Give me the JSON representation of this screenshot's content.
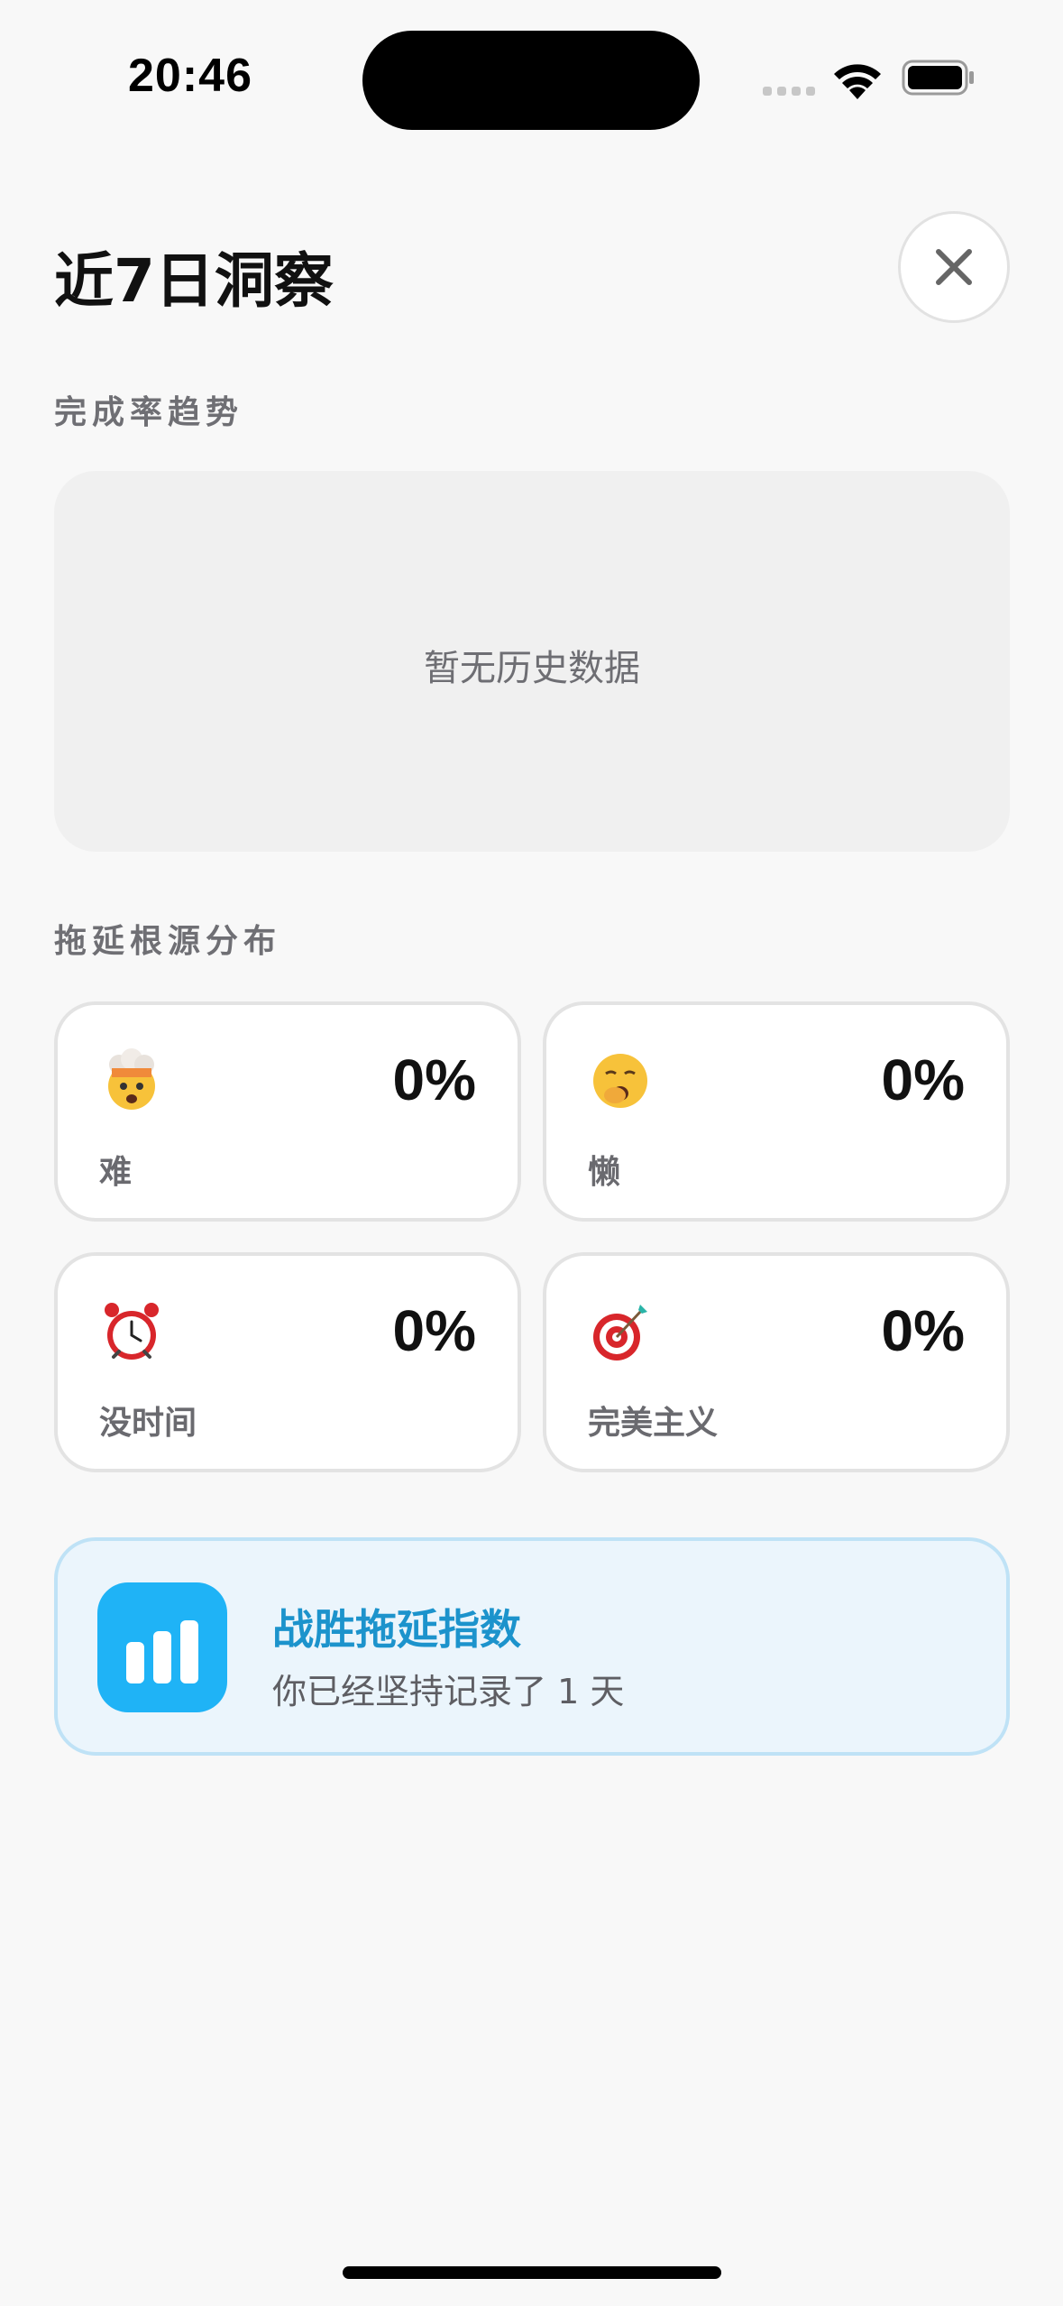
{
  "status_bar": {
    "time": "20:46"
  },
  "header": {
    "title": "近7日洞察",
    "close_icon": "close-icon"
  },
  "trend_section": {
    "label": "完成率趋势",
    "empty_text": "暂无历史数据"
  },
  "causes_section": {
    "label": "拖延根源分布",
    "items": [
      {
        "emoji": "exploding-head",
        "label": "难",
        "percent": "0%"
      },
      {
        "emoji": "yawning-face",
        "label": "懒",
        "percent": "0%"
      },
      {
        "emoji": "alarm-clock",
        "label": "没时间",
        "percent": "0%"
      },
      {
        "emoji": "direct-hit-target",
        "label": "完美主义",
        "percent": "0%"
      }
    ]
  },
  "index_card": {
    "icon": "bar-chart-icon",
    "title": "战胜拖延指数",
    "subtitle": "你已经坚持记录了 1 天"
  },
  "colors": {
    "background": "#f8f8f8",
    "accent_blue": "#1fb3f6",
    "index_title": "#1c93cc",
    "index_card_bg": "#ebf5fc"
  }
}
